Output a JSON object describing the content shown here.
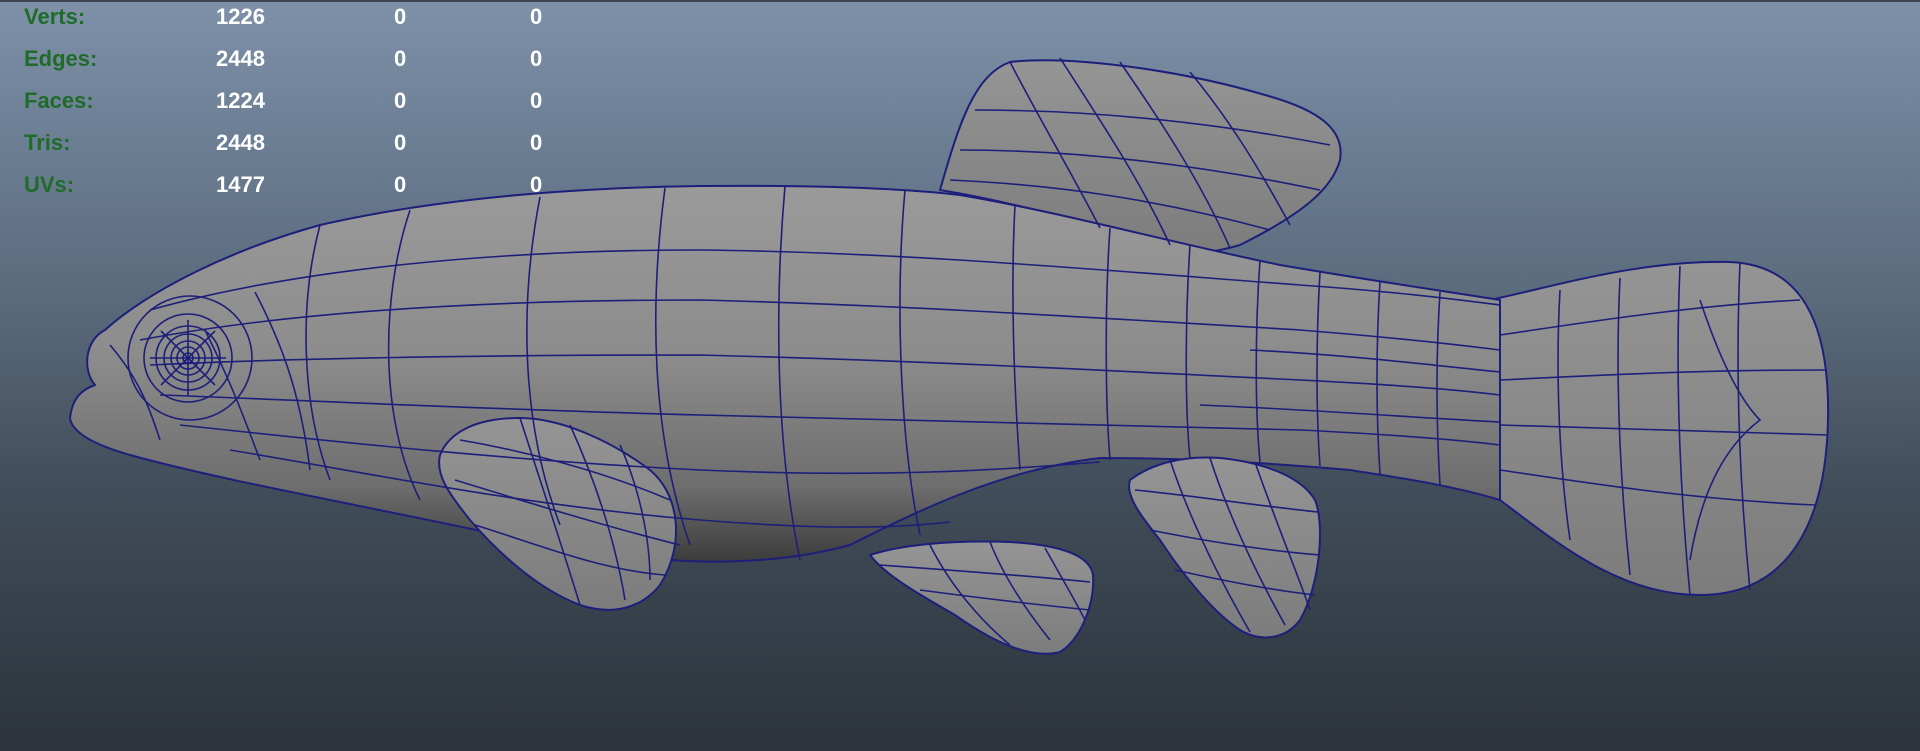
{
  "hud": {
    "rows": [
      {
        "label": "Verts:",
        "v1": "1226",
        "v2": "0",
        "v3": "0"
      },
      {
        "label": "Edges:",
        "v1": "2448",
        "v2": "0",
        "v3": "0"
      },
      {
        "label": "Faces:",
        "v1": "1224",
        "v2": "0",
        "v3": "0"
      },
      {
        "label": "Tris:",
        "v1": "2448",
        "v2": "0",
        "v3": "0"
      },
      {
        "label": "UVs:",
        "v1": "1477",
        "v2": "0",
        "v3": "0"
      }
    ]
  },
  "colors": {
    "label": "#1f6b2a",
    "value": "#ffffff",
    "wireframe": "#1d1f7a",
    "surface": "#8c8c8c"
  }
}
